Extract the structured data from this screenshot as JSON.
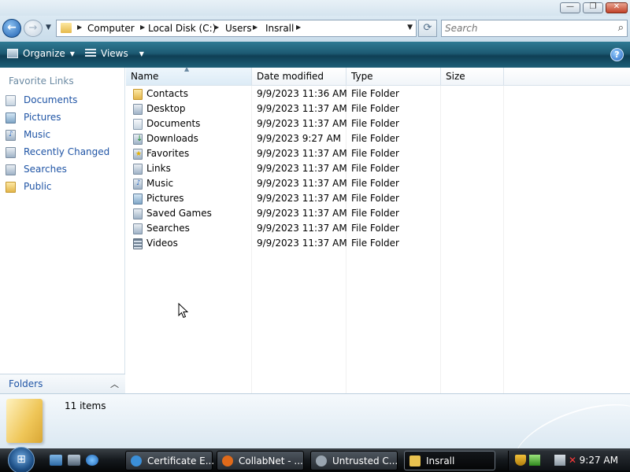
{
  "window": {
    "controls": {
      "minimize": "—",
      "maximize": "❐",
      "close": "✕"
    }
  },
  "nav": {
    "back": "←",
    "forward": "→",
    "recent": "▼",
    "refresh": "⟳"
  },
  "address": {
    "breadcrumbs": [
      "Computer",
      "Local Disk (C:)",
      "Users",
      "Insrall"
    ],
    "separator": "▶",
    "dropdown": "▼"
  },
  "search": {
    "placeholder": "Search",
    "icon": "search-icon"
  },
  "toolbar": {
    "organize_label": "Organize",
    "views_label": "Views",
    "caret": "▼",
    "help": "?"
  },
  "navpane": {
    "header": "Favorite Links",
    "items": [
      {
        "label": "Documents",
        "icon": "documents-icon"
      },
      {
        "label": "Pictures",
        "icon": "pictures-icon"
      },
      {
        "label": "Music",
        "icon": "music-icon"
      },
      {
        "label": "Recently Changed",
        "icon": "recently-changed-icon"
      },
      {
        "label": "Searches",
        "icon": "searches-icon"
      },
      {
        "label": "Public",
        "icon": "public-icon"
      }
    ],
    "folders_label": "Folders",
    "folders_chevron": "︿"
  },
  "filelist": {
    "columns": [
      "Name",
      "Date modified",
      "Type",
      "Size"
    ],
    "sort_indicator": "▲",
    "rows": [
      {
        "name": "Contacts",
        "date": "9/9/2023 11:36 AM",
        "type": "File Folder",
        "icon": "contacts-folder-icon"
      },
      {
        "name": "Desktop",
        "date": "9/9/2023 11:37 AM",
        "type": "File Folder",
        "icon": "desktop-folder-icon"
      },
      {
        "name": "Documents",
        "date": "9/9/2023 11:37 AM",
        "type": "File Folder",
        "icon": "documents-folder-icon"
      },
      {
        "name": "Downloads",
        "date": "9/9/2023 9:27 AM",
        "type": "File Folder",
        "icon": "downloads-folder-icon"
      },
      {
        "name": "Favorites",
        "date": "9/9/2023 11:37 AM",
        "type": "File Folder",
        "icon": "favorites-folder-icon"
      },
      {
        "name": "Links",
        "date": "9/9/2023 11:37 AM",
        "type": "File Folder",
        "icon": "links-folder-icon"
      },
      {
        "name": "Music",
        "date": "9/9/2023 11:37 AM",
        "type": "File Folder",
        "icon": "music-folder-icon"
      },
      {
        "name": "Pictures",
        "date": "9/9/2023 11:37 AM",
        "type": "File Folder",
        "icon": "pictures-folder-icon"
      },
      {
        "name": "Saved Games",
        "date": "9/9/2023 11:37 AM",
        "type": "File Folder",
        "icon": "saved-games-folder-icon"
      },
      {
        "name": "Searches",
        "date": "9/9/2023 11:37 AM",
        "type": "File Folder",
        "icon": "searches-folder-icon"
      },
      {
        "name": "Videos",
        "date": "9/9/2023 11:37 AM",
        "type": "File Folder",
        "icon": "videos-folder-icon"
      }
    ]
  },
  "details": {
    "item_count": "11 items"
  },
  "taskbar": {
    "start": "⊞",
    "tasks": [
      {
        "label": "Certificate E...",
        "icon": "ie-icon",
        "color": "#3b8fd8"
      },
      {
        "label": "CollabNet - ...",
        "icon": "firefox-icon",
        "color": "#e06a1a"
      },
      {
        "label": "Untrusted C...",
        "icon": "untrusted-icon",
        "color": "#9aa5b0"
      },
      {
        "label": "Insrall",
        "icon": "folder-icon",
        "color": "#e9c24f"
      }
    ],
    "clock": "9:27 AM"
  }
}
